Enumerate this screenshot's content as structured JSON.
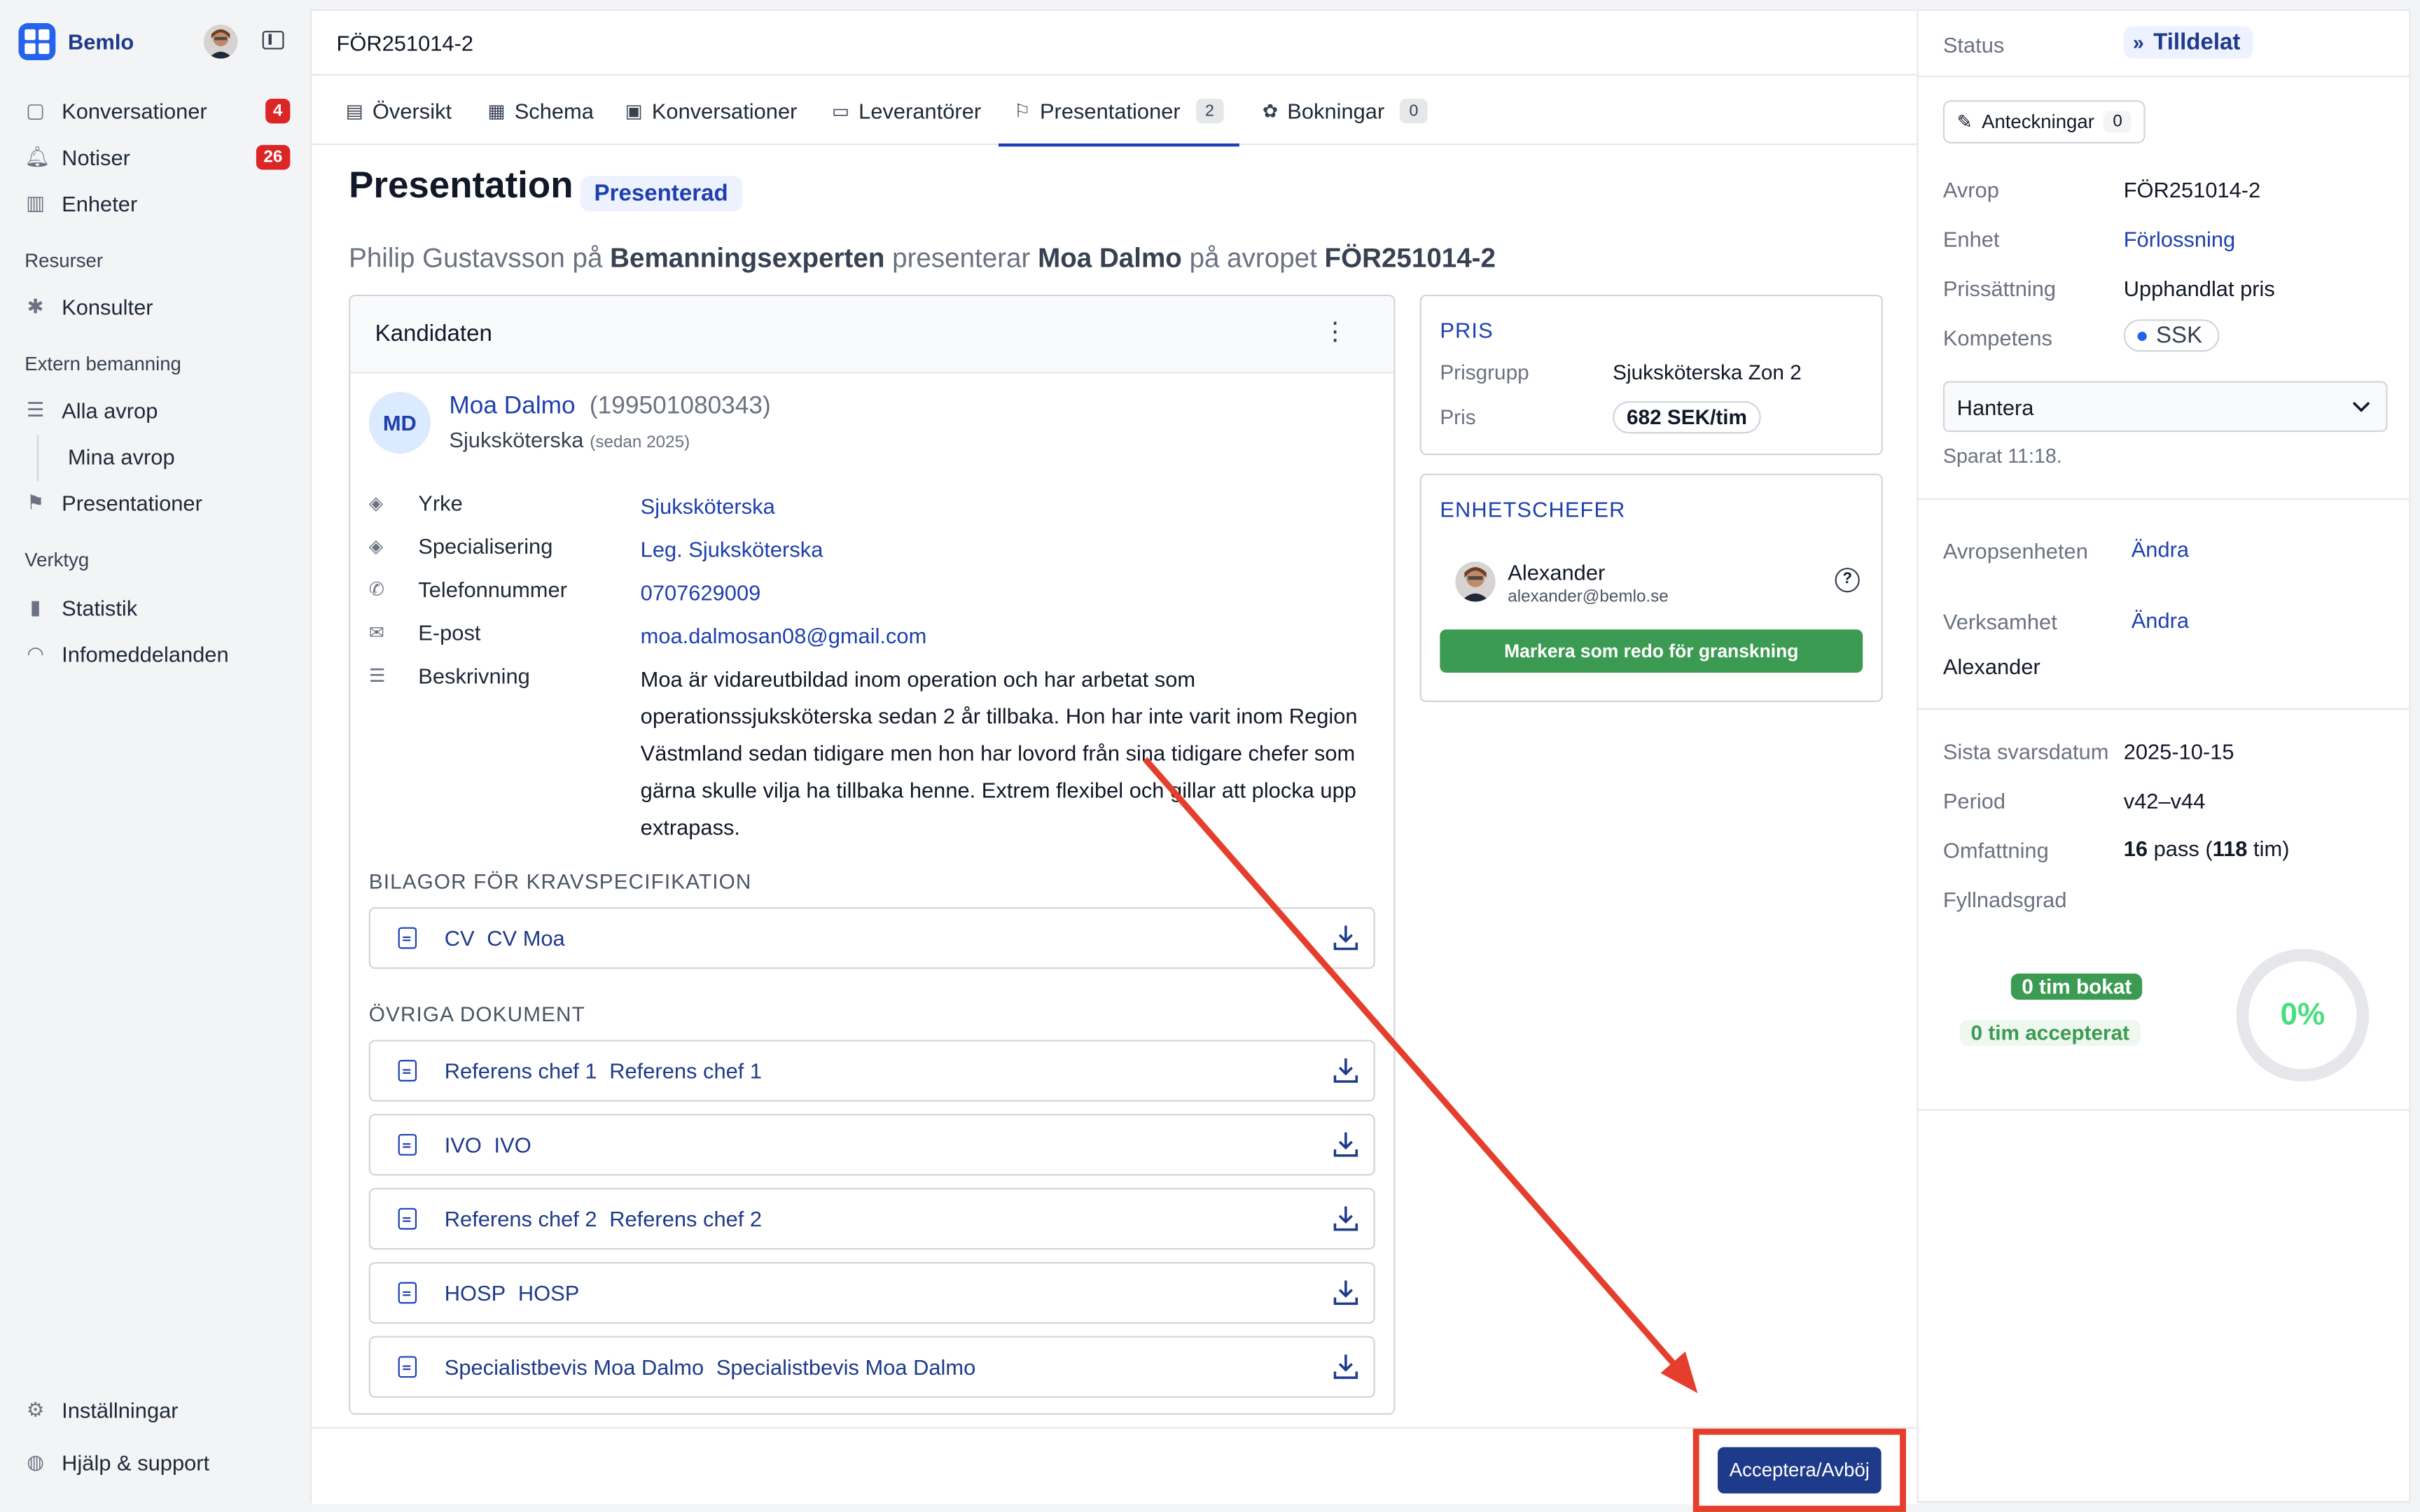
{
  "app": {
    "name": "Bemlo"
  },
  "sidebar": {
    "items": [
      {
        "label": "Konversationer",
        "badge": "4",
        "icon": "chat-icon"
      },
      {
        "label": "Notiser",
        "badge": "26",
        "icon": "bell-icon"
      },
      {
        "label": "Enheter",
        "icon": "building-icon"
      }
    ],
    "sections": {
      "resources": "Resurser",
      "external": "Extern bemanning",
      "tools": "Verktyg"
    },
    "resources_items": [
      {
        "label": "Konsulter",
        "icon": "puzzle-icon"
      }
    ],
    "external_items": [
      {
        "label": "Alla avrop",
        "icon": "stack-icon"
      },
      {
        "label": "Mina avrop"
      },
      {
        "label": "Presentationer",
        "icon": "flag-icon"
      }
    ],
    "tools_items": [
      {
        "label": "Statistik",
        "icon": "bar-chart-icon"
      },
      {
        "label": "Infomeddelanden",
        "icon": "rss-icon"
      }
    ],
    "bottom": [
      {
        "label": "Inställningar",
        "icon": "gear-icon"
      },
      {
        "label": "Hjälp & support",
        "icon": "globe-icon"
      }
    ]
  },
  "main": {
    "title": "FÖR251014-2",
    "tabs": [
      {
        "label": "Översikt"
      },
      {
        "label": "Schema"
      },
      {
        "label": "Konversationer"
      },
      {
        "label": "Leverantörer"
      },
      {
        "label": "Presentationer",
        "count": "2"
      },
      {
        "label": "Bokningar",
        "count": "0"
      }
    ],
    "heading": "Presentation",
    "status": "Presenterad",
    "subtitle": {
      "p1": "Philip Gustavsson på ",
      "agency": "Bemanningsexperten",
      "p2": " presenterar ",
      "candidate": "Moa Dalmo",
      "p3": " på avropet ",
      "ref": "FÖR251014-2"
    }
  },
  "candidate": {
    "card_title": "Kandidaten",
    "initials": "MD",
    "name": "Moa Dalmo",
    "personal_number": "(199501080343)",
    "role": "Sjuksköterska",
    "since": "(sedan 2025)",
    "fields": [
      {
        "label": "Yrke",
        "value": "Sjuksköterska"
      },
      {
        "label": "Specialisering",
        "value": "Leg. Sjuksköterska"
      },
      {
        "label": "Telefonnummer",
        "value": "0707629009"
      },
      {
        "label": "E-post",
        "value": "moa.dalmosan08@gmail.com"
      },
      {
        "label": "Beskrivning"
      }
    ],
    "description": "Moa är vidareutbildad inom operation och har arbetat som operationssjuksköterska sedan 2 år tillbaka. Hon har inte varit inom Region Västmland sedan tidigare men hon har lovord från sina tidigare chefer som gärna skulle vilja ha tillbaka henne. Extrem flexibel och gillar att plocka upp extrapass.",
    "attachments_title": "BILAGOR FÖR KRAVSPECIFIKATION",
    "attachments": [
      {
        "name": "CV",
        "title": "CV Moa"
      }
    ],
    "other_title": "ÖVRIGA DOKUMENT",
    "other_docs": [
      {
        "name": "Referens chef 1",
        "title": "Referens chef 1"
      },
      {
        "name": "IVO",
        "title": "IVO"
      },
      {
        "name": "Referens chef 2",
        "title": "Referens chef 2"
      },
      {
        "name": "HOSP",
        "title": "HOSP"
      },
      {
        "name": "Specialistbevis Moa Dalmo",
        "title": "Specialistbevis Moa Dalmo"
      }
    ]
  },
  "price": {
    "title": "PRIS",
    "group_label": "Prisgrupp",
    "group_value": "Sjuksköterska Zon 2",
    "price_label": "Pris",
    "price_value": "682 SEK/tim"
  },
  "managers": {
    "title": "ENHETSCHEFER",
    "name": "Alexander",
    "email": "alexander@bemlo.se",
    "action": "Markera som redo för granskning"
  },
  "footer": {
    "accept_button": "Acceptera/Avböj"
  },
  "right": {
    "status_label": "Status",
    "status_value": "Tilldelat",
    "notes_label": "Anteckningar",
    "notes_count": "0",
    "rows": [
      {
        "label": "Avrop",
        "value": "FÖR251014-2"
      },
      {
        "label": "Enhet",
        "value": "Förlossning"
      },
      {
        "label": "Prissättning",
        "value": "Upphandlat pris"
      },
      {
        "label": "Kompetens",
        "value": "SSK"
      }
    ],
    "select_value": "Hantera",
    "saved": "Sparat 11:18.",
    "unit_label": "Avropsenheten",
    "unit_action": "Ändra",
    "business_label": "Verksamhet",
    "business_action": "Ändra",
    "business_value": "Alexander",
    "deadline_label": "Sista svarsdatum",
    "deadline_value": "2025-10-15",
    "period_label": "Period",
    "period_value": "v42–v44",
    "scope_label": "Omfattning",
    "scope_pass": "16",
    "scope_pass_unit": "pass",
    "scope_hours": "118",
    "scope_hours_unit": "tim",
    "fill_label": "Fyllnadsgrad",
    "booked": "0 tim bokat",
    "accepted": "0 tim accepterat",
    "fill_percent": "0%"
  },
  "colors": {
    "accent": "#1e3a8a",
    "green": "#3c9b52",
    "red": "#dc2626",
    "highlight": "#e53e2d"
  }
}
